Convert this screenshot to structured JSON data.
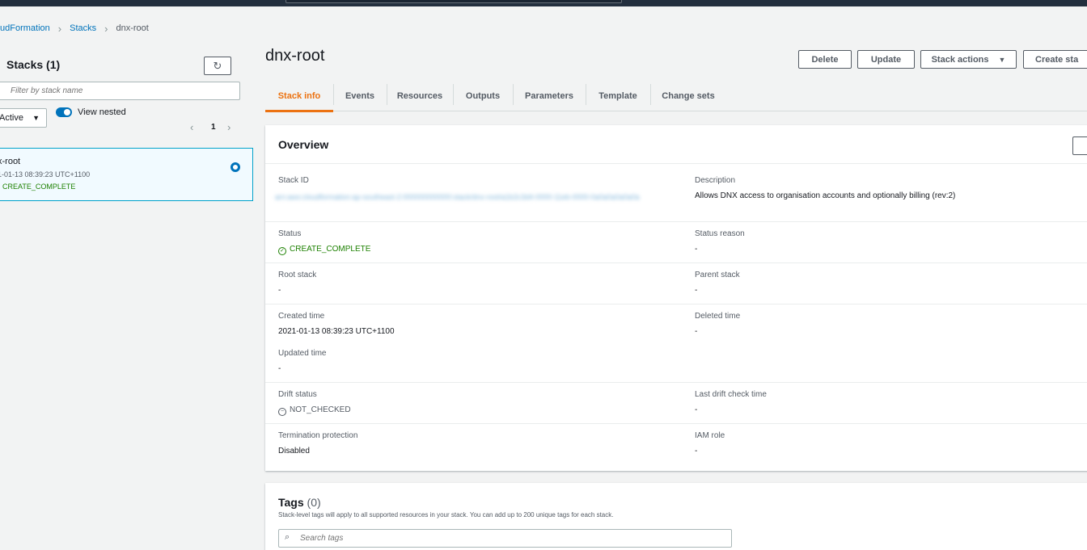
{
  "breadcrumb": {
    "service": "udFormation",
    "stacks": "Stacks",
    "current": "dnx-root"
  },
  "left_panel": {
    "title": "Stacks",
    "count": "(1)",
    "filter_placeholder": "Filter by stack name",
    "status_filter": "Active",
    "toggle_label": "View nested",
    "page": "1",
    "stack": {
      "name": "x-root",
      "time": "1-01-13 08:39:23 UTC+1100",
      "status": "CREATE_COMPLETE"
    }
  },
  "header": {
    "title": "dnx-root",
    "delete_label": "Delete",
    "update_label": "Update",
    "stack_actions_label": "Stack actions",
    "create_label": "Create sta"
  },
  "tabs": [
    "Stack info",
    "Events",
    "Resources",
    "Outputs",
    "Parameters",
    "Template",
    "Change sets"
  ],
  "overview": {
    "title": "Overview",
    "stack_id_label": "Stack ID",
    "stack_id_value": "arn:aws:cloudformation:ap-southeast-2:000000000000:stack/dnx-root/a1b2c3d4-0000-11eb-0000-0a0a0a0a0a0a",
    "description_label": "Description",
    "description_value": "Allows DNX access to organisation accounts and optionally billing (rev:2)",
    "status_label": "Status",
    "status_value": "CREATE_COMPLETE",
    "status_reason_label": "Status reason",
    "status_reason_value": "-",
    "root_stack_label": "Root stack",
    "root_stack_value": "-",
    "parent_stack_label": "Parent stack",
    "parent_stack_value": "-",
    "created_time_label": "Created time",
    "created_time_value": "2021-01-13 08:39:23 UTC+1100",
    "deleted_time_label": "Deleted time",
    "deleted_time_value": "-",
    "updated_time_label": "Updated time",
    "updated_time_value": "-",
    "drift_status_label": "Drift status",
    "drift_status_value": "NOT_CHECKED",
    "last_drift_label": "Last drift check time",
    "last_drift_value": "-",
    "termination_label": "Termination protection",
    "termination_value": "Disabled",
    "iam_role_label": "IAM role",
    "iam_role_value": "-"
  },
  "tags": {
    "title": "Tags",
    "count": "(0)",
    "description": "Stack-level tags will apply to all supported resources in your stack. You can add up to 200 unique tags for each stack.",
    "search_placeholder": "Search tags"
  },
  "colors": {
    "link": "#0073bb",
    "active_tab": "#ec7211",
    "success": "#1d8102",
    "topbar": "#232f3e"
  }
}
